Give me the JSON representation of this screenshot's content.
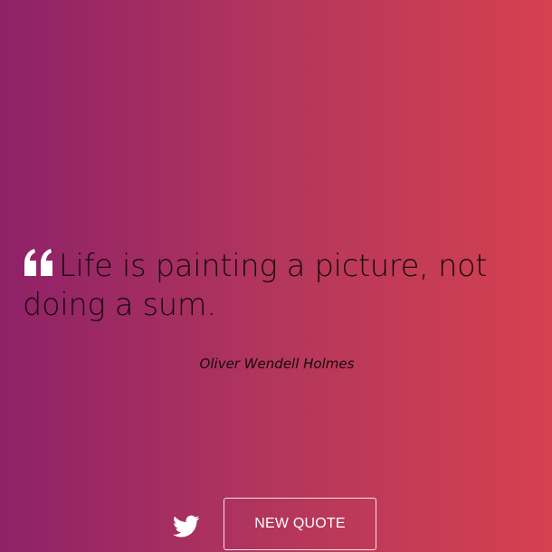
{
  "quote": {
    "icon": "quote-left-icon",
    "text": "Life is painting a picture, not doing a sum.",
    "author": "Oliver Wendell Holmes"
  },
  "actions": {
    "tweet_icon": "twitter-icon",
    "new_quote_label": "NEW QUOTE"
  },
  "colors": {
    "gradient_start": "#8e2168",
    "gradient_end": "#d6414f",
    "text": "#14070d",
    "button_text": "#ffffff"
  }
}
